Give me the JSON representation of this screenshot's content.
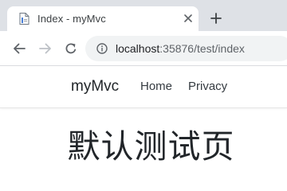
{
  "tab": {
    "title": "Index - myMvc",
    "favicon": "document-icon"
  },
  "toolbar": {
    "url_host": "localhost",
    "url_rest": ":35876/test/index"
  },
  "site": {
    "brand": "myMvc",
    "nav": [
      {
        "label": "Home"
      },
      {
        "label": "Privacy"
      }
    ]
  },
  "main": {
    "heading": "默认测试页"
  },
  "colors": {
    "tabstrip_bg": "#dee1e6",
    "omnibox_bg": "#f1f3f4",
    "favicon_blue": "#4a7fd6"
  }
}
